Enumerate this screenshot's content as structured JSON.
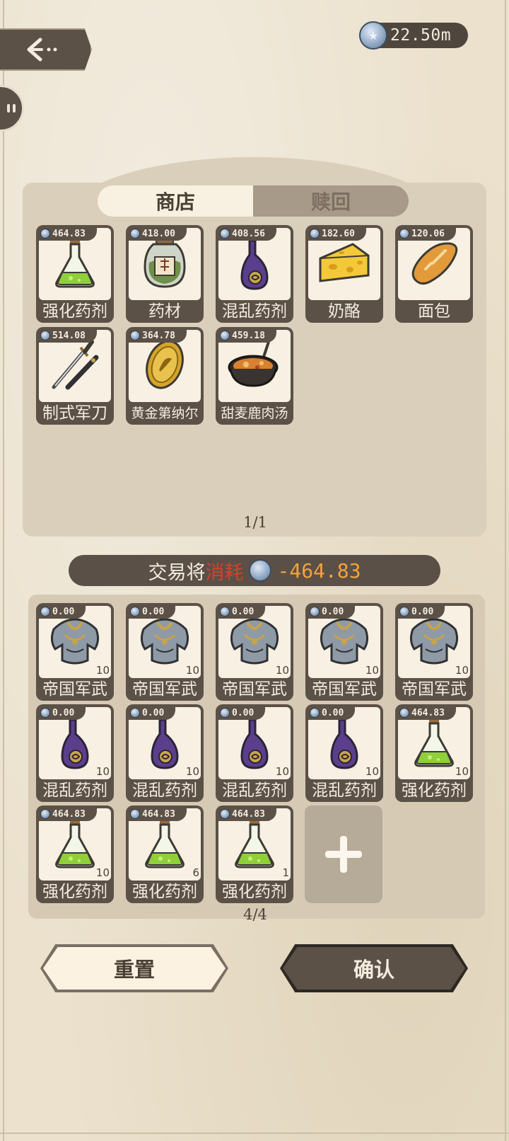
{
  "header": {
    "currency_value": "22.50m"
  },
  "tabs": [
    {
      "label": "商店",
      "active": true
    },
    {
      "label": "赎回",
      "active": false
    }
  ],
  "shop": {
    "page": "1/1",
    "items": [
      {
        "name": "强化药剂",
        "price": "464.83",
        "icon": "green-potion-flask-icon"
      },
      {
        "name": "药材",
        "price": "418.00",
        "icon": "herb-jar-icon"
      },
      {
        "name": "混乱药剂",
        "price": "408.56",
        "icon": "purple-potion-bottle-icon"
      },
      {
        "name": "奶酪",
        "price": "182.60",
        "icon": "cheese-icon"
      },
      {
        "name": "面包",
        "price": "120.06",
        "icon": "bread-icon"
      },
      {
        "name": "制式军刀",
        "price": "514.08",
        "icon": "sabre-icon"
      },
      {
        "name": "黄金第纳尔",
        "price": "364.78",
        "icon": "gold-coin-icon"
      },
      {
        "name": "甜麦鹿肉汤",
        "price": "459.18",
        "icon": "stew-pot-icon"
      }
    ]
  },
  "cost": {
    "label_prefix": "交易将",
    "label_highlight": "消耗",
    "value": "-464.83",
    "value_color": "#f5a23a"
  },
  "bag": {
    "page": "4/4",
    "items": [
      {
        "name": "帝国军武",
        "price": "0.00",
        "qty": "10",
        "icon": "armor-icon"
      },
      {
        "name": "帝国军武",
        "price": "0.00",
        "qty": "10",
        "icon": "armor-icon"
      },
      {
        "name": "帝国军武",
        "price": "0.00",
        "qty": "10",
        "icon": "armor-icon"
      },
      {
        "name": "帝国军武",
        "price": "0.00",
        "qty": "10",
        "icon": "armor-icon"
      },
      {
        "name": "帝国军武",
        "price": "0.00",
        "qty": "10",
        "icon": "armor-icon"
      },
      {
        "name": "混乱药剂",
        "price": "0.00",
        "qty": "10",
        "icon": "purple-potion-bottle-icon"
      },
      {
        "name": "混乱药剂",
        "price": "0.00",
        "qty": "10",
        "icon": "purple-potion-bottle-icon"
      },
      {
        "name": "混乱药剂",
        "price": "0.00",
        "qty": "10",
        "icon": "purple-potion-bottle-icon"
      },
      {
        "name": "混乱药剂",
        "price": "0.00",
        "qty": "10",
        "icon": "purple-potion-bottle-icon"
      },
      {
        "name": "强化药剂",
        "price": "464.83",
        "qty": "10",
        "icon": "green-potion-flask-icon"
      },
      {
        "name": "强化药剂",
        "price": "464.83",
        "qty": "10",
        "icon": "green-potion-flask-icon"
      },
      {
        "name": "强化药剂",
        "price": "464.83",
        "qty": "6",
        "icon": "green-potion-flask-icon"
      },
      {
        "name": "强化药剂",
        "price": "464.83",
        "qty": "1",
        "icon": "green-potion-flask-icon"
      }
    ]
  },
  "buttons": {
    "reset_label": "重置",
    "confirm_label": "确认"
  }
}
